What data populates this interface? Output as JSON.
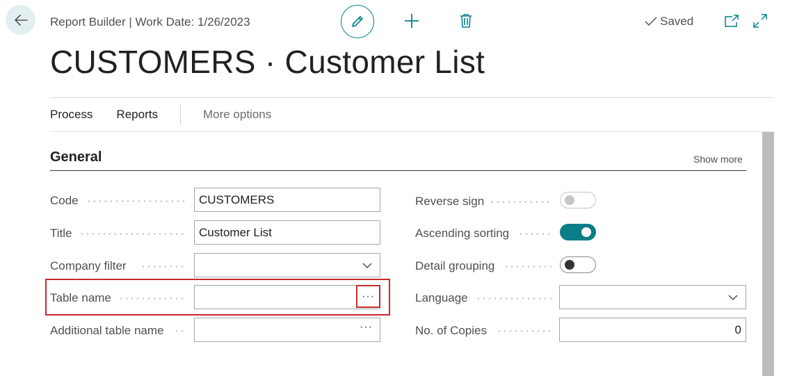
{
  "header": {
    "breadcrumb": "Report Builder | Work Date: 1/26/2023",
    "saved_label": "Saved",
    "title": "CUSTOMERS · Customer List"
  },
  "actions": {
    "process": "Process",
    "reports": "Reports",
    "more": "More options"
  },
  "section": {
    "title": "General",
    "show_more": "Show more"
  },
  "fields_left": {
    "code": {
      "label": "Code",
      "value": "CUSTOMERS"
    },
    "title": {
      "label": "Title",
      "value": "Customer List"
    },
    "company_filter": {
      "label": "Company filter",
      "value": ""
    },
    "table_name": {
      "label": "Table name",
      "value": ""
    },
    "additional_table_name": {
      "label": "Additional table name",
      "value": ""
    }
  },
  "fields_right": {
    "reverse_sign": {
      "label": "Reverse sign",
      "state": "off-disabled"
    },
    "ascending_sorting": {
      "label": "Ascending sorting",
      "state": "on"
    },
    "detail_grouping": {
      "label": "Detail grouping",
      "state": "off"
    },
    "language": {
      "label": "Language",
      "value": ""
    },
    "no_of_copies": {
      "label": "No. of Copies",
      "value": "0"
    }
  },
  "ellipsis_glyph": "···",
  "colors": {
    "accent": "#00828e",
    "toggle_on": "#0a7d86",
    "highlight": "#c42a2f"
  },
  "icons": [
    "back-arrow-icon",
    "pencil-icon",
    "plus-icon",
    "trash-icon",
    "checkmark-icon",
    "open-new-window-icon",
    "expand-icon",
    "chevron-down-icon",
    "ellipsis-icon"
  ]
}
